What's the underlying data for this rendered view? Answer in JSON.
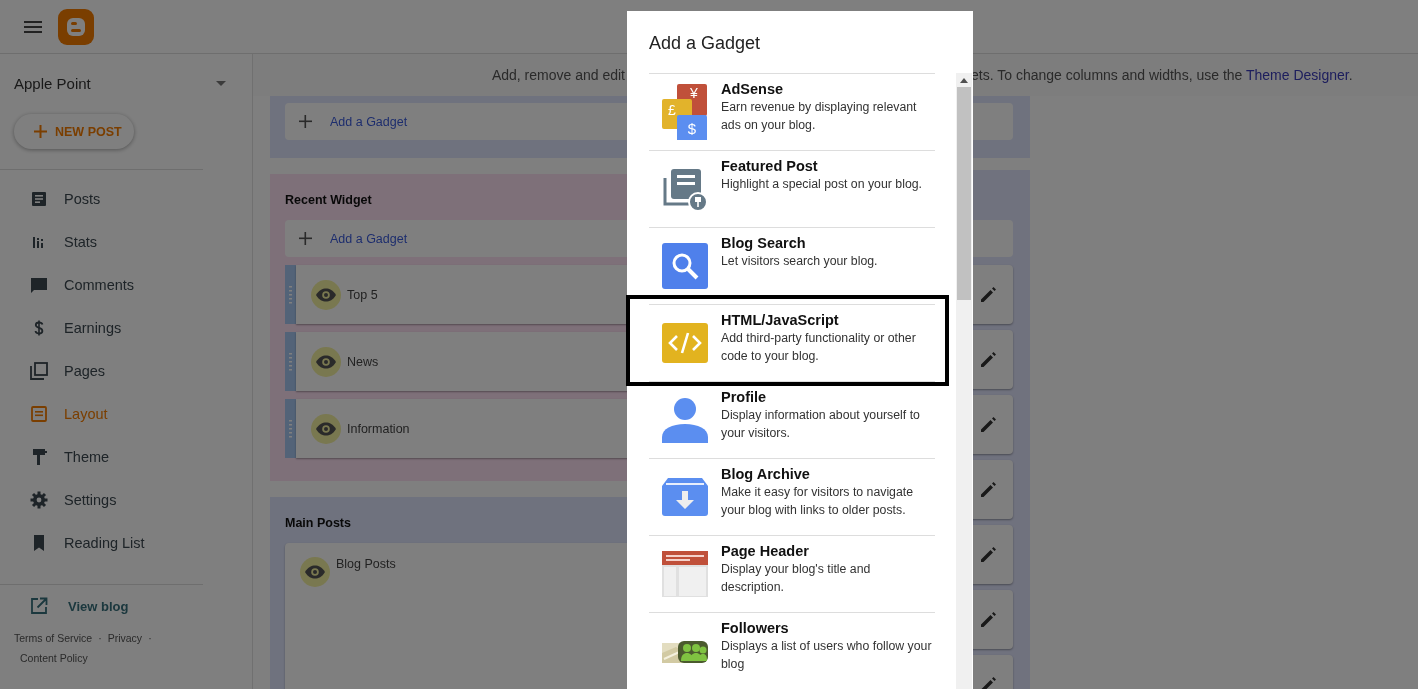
{
  "header": {
    "blog_name": "Apple Point"
  },
  "sidebar": {
    "new_post": "NEW POST",
    "items": [
      {
        "label": "Posts",
        "kind": "posts",
        "selected": false
      },
      {
        "label": "Stats",
        "kind": "stats",
        "selected": false
      },
      {
        "label": "Comments",
        "kind": "comments",
        "selected": false
      },
      {
        "label": "Earnings",
        "kind": "earnings",
        "selected": false
      },
      {
        "label": "Pages",
        "kind": "pages",
        "selected": false
      },
      {
        "label": "Layout",
        "kind": "layout",
        "selected": true
      },
      {
        "label": "Theme",
        "kind": "theme",
        "selected": false
      },
      {
        "label": "Settings",
        "kind": "settings",
        "selected": false
      },
      {
        "label": "Reading List",
        "kind": "reading",
        "selected": false
      }
    ],
    "view_blog": "View blog",
    "footer_links": [
      {
        "label": "Terms of Service",
        "separator": "·"
      },
      {
        "label": "Privacy",
        "separator": "·"
      },
      {
        "label": "Content Policy"
      }
    ]
  },
  "info": {
    "before": "Add, remove and edit",
    "after": "ets. To change columns and widths, use the ",
    "link": "Theme Designer",
    "end": "."
  },
  "layout": {
    "top_panel": {
      "add_gadget": "Add a Gadget"
    },
    "sections": [
      {
        "title": "Recent Widget",
        "kind": "widgets",
        "add_gadget": "Add a Gadget",
        "gadgets": [
          {
            "title": "Top 5",
            "draggable": true
          },
          {
            "title": "News",
            "draggable": true
          },
          {
            "title": "Information",
            "draggable": true
          }
        ]
      },
      {
        "title": "Main Posts",
        "kind": "posts",
        "gadgets": [
          {
            "title": "Blog Posts",
            "draggable": false
          }
        ]
      }
    ],
    "side_column": {
      "gadgets": [
        {
          "editable": true
        },
        {
          "editable": true
        },
        {
          "editable": true
        },
        {
          "editable": true
        },
        {
          "editable": true
        },
        {
          "editable": true
        },
        {
          "editable": true
        }
      ]
    }
  },
  "dialog": {
    "title": "Add a Gadget",
    "gadgets": [
      {
        "kind": "adsense",
        "title": "AdSense",
        "description": "Earn revenue by displaying relevant ads on your blog.",
        "icon_symbols": [
          "¥",
          "£",
          "$"
        ],
        "highlighted": false
      },
      {
        "kind": "featured",
        "title": "Featured Post",
        "description": "Highlight a special post on your blog.",
        "highlighted": false
      },
      {
        "kind": "search",
        "title": "Blog Search",
        "description": "Let visitors search your blog.",
        "highlighted": false
      },
      {
        "kind": "html",
        "title": "HTML/JavaScript",
        "description": "Add third-party functionality or other code to your blog.",
        "highlighted": true
      },
      {
        "kind": "profile",
        "title": "Profile",
        "description": "Display information about yourself to your visitors.",
        "highlighted": false
      },
      {
        "kind": "archive",
        "title": "Blog Archive",
        "description": "Make it easy for visitors to navigate your blog with links to older posts.",
        "highlighted": false
      },
      {
        "kind": "header",
        "title": "Page Header",
        "description": "Display your blog's title and description.",
        "highlighted": false
      },
      {
        "kind": "followers",
        "title": "Followers",
        "description": "Displays a list of users who follow your blog",
        "highlighted": false
      }
    ]
  }
}
